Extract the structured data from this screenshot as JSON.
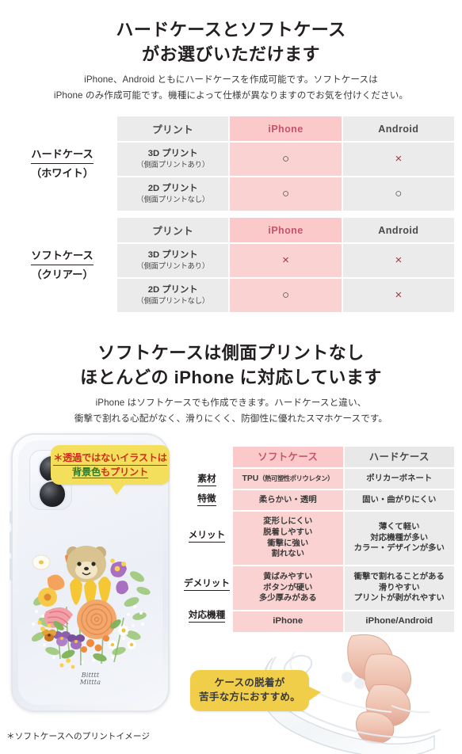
{
  "section1": {
    "headline_line1": "ハードケースとソフトケース",
    "headline_line2": "がお選びいただけます",
    "lead_line1": "iPhone、Android ともにハードケースを作成可能です。ソフトケースは",
    "lead_line2": "iPhone のみ作成可能です。機種によって仕様が異なりますのでお気を付けください。",
    "tables": [
      {
        "row_label_main": "ハードケース",
        "row_label_sub": "（ホワイト）",
        "headers": [
          "プリント",
          "iPhone",
          "Android"
        ],
        "rows": [
          {
            "print_main": "3D プリント",
            "print_sub": "（側面プリントあり）",
            "iphone": "○",
            "android": "×"
          },
          {
            "print_main": "2D プリント",
            "print_sub": "（側面プリントなし）",
            "iphone": "○",
            "android": "○"
          }
        ]
      },
      {
        "row_label_main": "ソフトケース",
        "row_label_sub": "（クリアー）",
        "headers": [
          "プリント",
          "iPhone",
          "Android"
        ],
        "rows": [
          {
            "print_main": "3D プリント",
            "print_sub": "（側面プリントあり）",
            "iphone": "×",
            "android": "×"
          },
          {
            "print_main": "2D プリント",
            "print_sub": "（側面プリントなし）",
            "iphone": "○",
            "android": "×"
          }
        ]
      }
    ]
  },
  "section2": {
    "headline_line1": "ソフトケースは側面プリントなし",
    "headline_line2": "ほとんどの iPhone に対応しています",
    "lead_line1": "iPhone はソフトケースでも作成できます。ハードケースと違い、",
    "lead_line2": "衝撃で割れる心配がなく、滑りにくく、防御性に優れたスマホケースです。",
    "spec_table": {
      "headers": [
        "ソフトケース",
        "ハードケース"
      ],
      "rows": [
        {
          "label": "素材",
          "soft_main": "TPU",
          "soft_sub": "（熱可塑性ポリウレタン）",
          "hard": "ポリカーボネート"
        },
        {
          "label": "特徴",
          "soft": "柔らかい・透明",
          "hard": "固い・曲がりにくい"
        },
        {
          "label": "メリット",
          "soft": "変形しにくい\n脱着しやすい\n衝撃に強い\n割れない",
          "hard": "薄くて軽い\n対応機種が多い\nカラー・デザインが多い"
        },
        {
          "label": "デメリット",
          "soft": "黄ばみやすい\nボタンが硬い\n多少厚みがある",
          "hard": "衝撃で割れることがある\n滑りやすい\nプリントが剥がれやすい"
        },
        {
          "label": "対応機種",
          "soft": "iPhone",
          "hard": "iPhone/Android"
        }
      ]
    },
    "callout_print_line1": "＊透過ではないイラストは",
    "callout_print_line2_a": "背景色",
    "callout_print_line2_b": "もプリント",
    "callout_remove_line1": "ケースの脱着が",
    "callout_remove_line2": "苦手な方におすすめ。",
    "phone_signature_line1": "Bitttt",
    "phone_signature_line2": "Mittta",
    "caption": "＊ソフトケースへのプリントイメージ"
  },
  "colors": {
    "pink_header": "#fbc9c9",
    "pink_cell": "#fbd2d2",
    "gray_cell": "#ebebeb",
    "iphone_text": "#c4566a",
    "cross": "#9e3b3b",
    "circle": "#3d3d3d",
    "callout_yellow": "#f4df5c",
    "callout_red": "#cf2d1e"
  }
}
